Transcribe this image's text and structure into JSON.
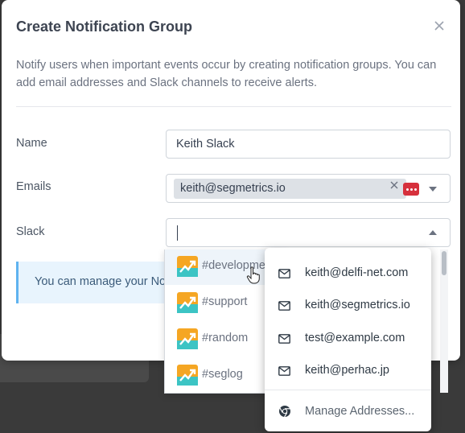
{
  "modal": {
    "title": "Create Notification Group",
    "description": "Notify users when important events occur by creating notification groups. You can add email addresses and Slack channels to receive alerts."
  },
  "form": {
    "name_label": "Name",
    "name_value": "Keith Slack",
    "emails_label": "Emails",
    "email_chip": "keith@segmetrics.io",
    "slack_label": "Slack",
    "slack_value": ""
  },
  "info": {
    "text": "You can manage your Not"
  },
  "slack_channels": [
    {
      "label": "#developme"
    },
    {
      "label": "#support"
    },
    {
      "label": "#random"
    },
    {
      "label": "#seglog"
    }
  ],
  "email_suggestions": [
    {
      "label": "keith@delfi-net.com"
    },
    {
      "label": "keith@segmetrics.io"
    },
    {
      "label": "test@example.com"
    },
    {
      "label": "keith@perhac.jp"
    }
  ],
  "manage_addresses": "Manage Addresses...",
  "colors": {
    "slack_logo_orange": "#f5a623",
    "slack_logo_teal": "#3cc4c4",
    "extension_badge": "#d6303c",
    "info_accent": "#5fb3f0"
  },
  "icons": {
    "close": "close-icon",
    "mail": "mail-icon",
    "chrome": "chrome-icon",
    "slack": "slack-channel-logo"
  }
}
